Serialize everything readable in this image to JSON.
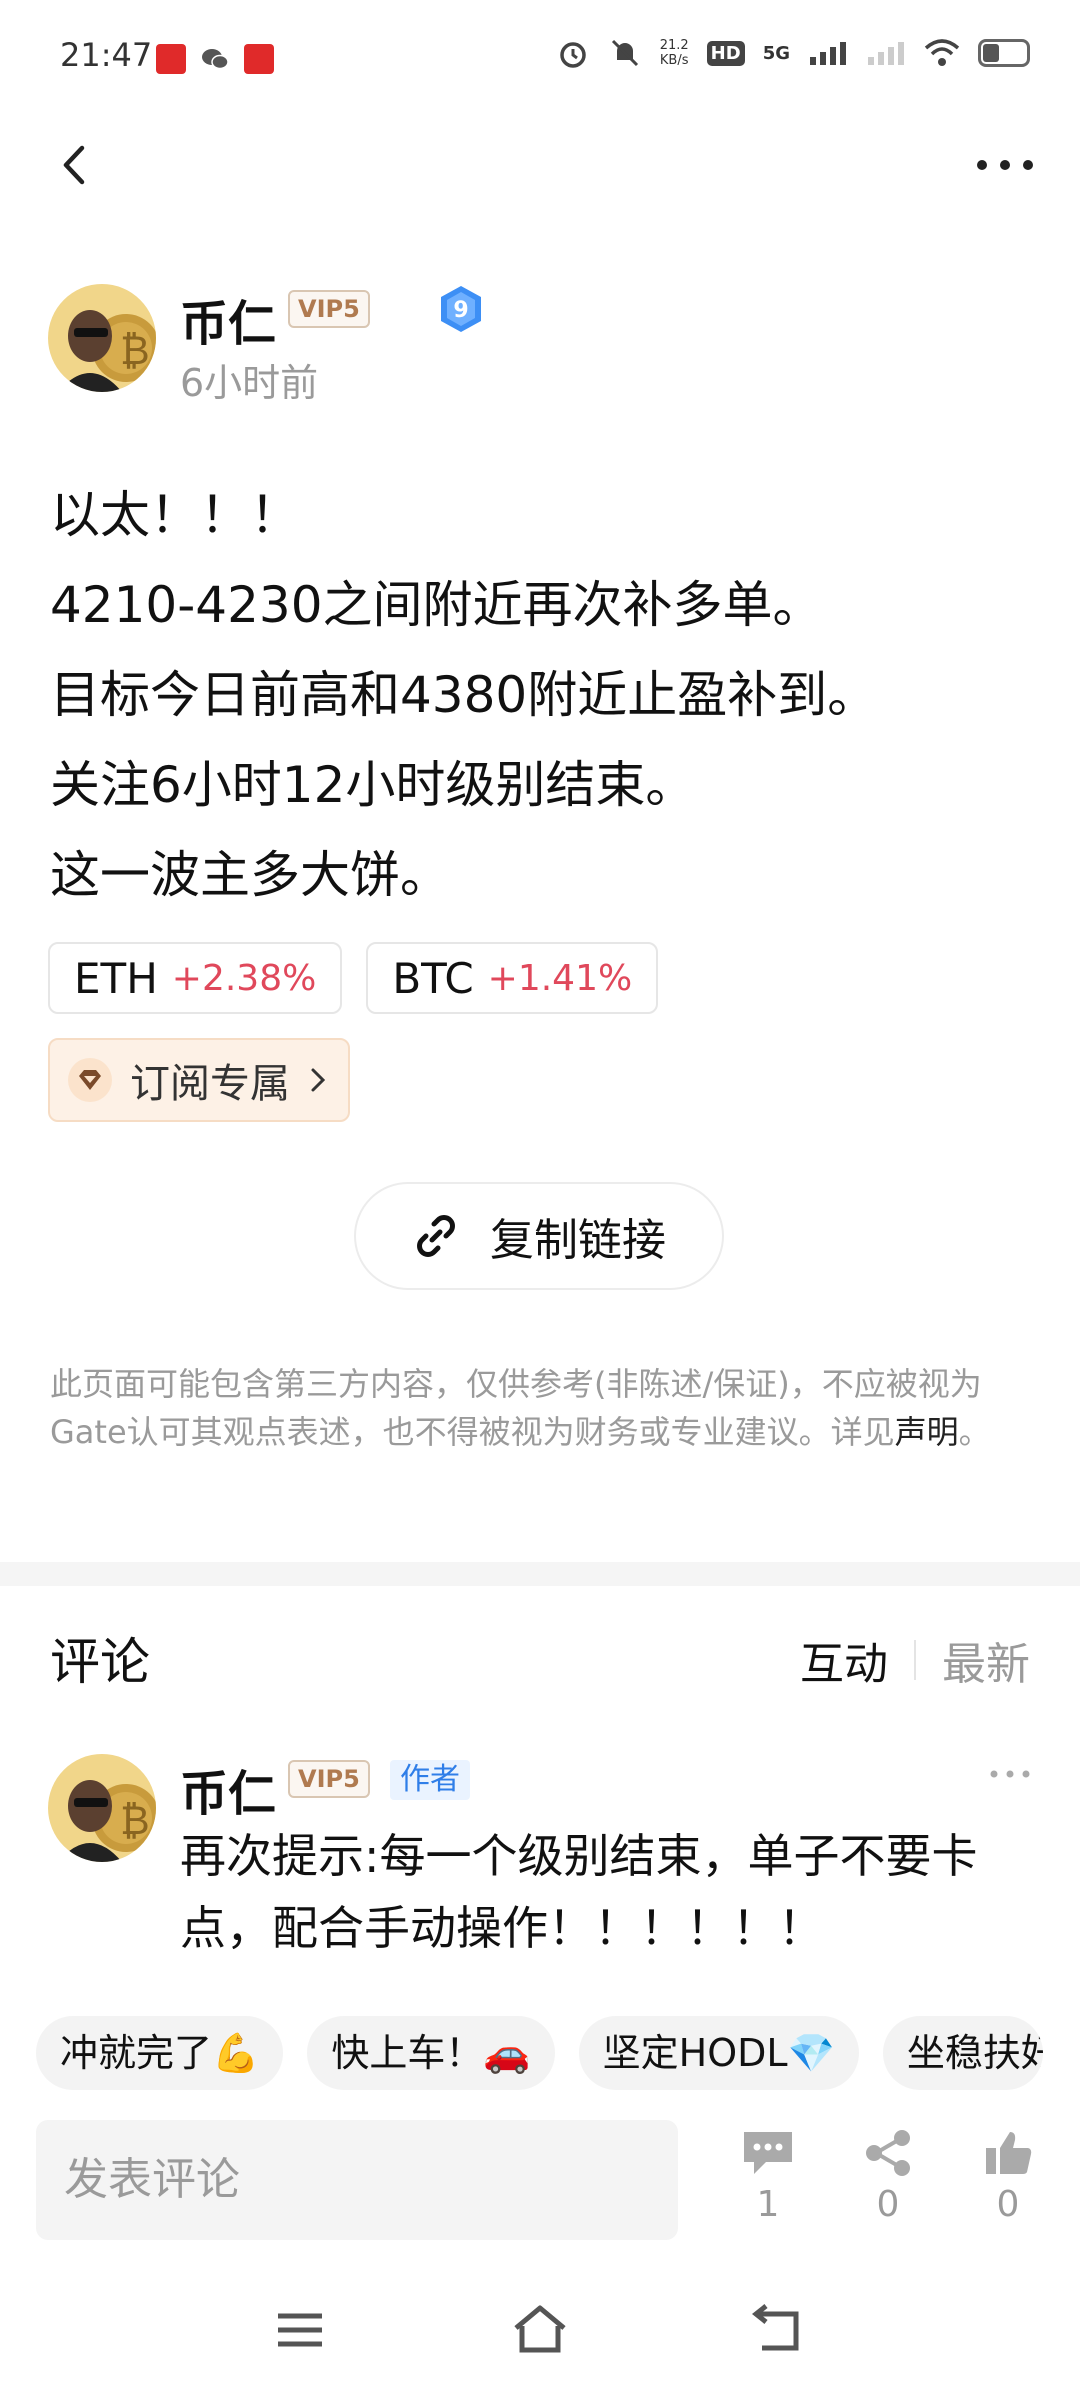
{
  "status_bar": {
    "time": "21:47",
    "net_speed_value": "21.2",
    "net_speed_unit": "KB/s",
    "hd_label": "HD",
    "sim_index": "1",
    "network": "5G"
  },
  "author": {
    "name": "币仁",
    "vip": "VIP5",
    "level": "9",
    "time": "6小时前"
  },
  "post": {
    "lines": [
      "以太！！！",
      "4210-4230之间附近再次补多单。",
      "目标今日前高和4380附近止盈补到。",
      "关注6小时12小时级别结束。",
      "这一波主多大饼。"
    ]
  },
  "tickers": [
    {
      "symbol": "ETH",
      "change": "+2.38%"
    },
    {
      "symbol": "BTC",
      "change": "+1.41%"
    }
  ],
  "subscribe": {
    "label": "订阅专属"
  },
  "copy_link": {
    "label": "复制链接"
  },
  "disclaimer": {
    "text": "此页面可能包含第三方内容，仅供参考(非陈述/保证)，不应被视为Gate认可其观点表述，也不得被视为财务或专业建议。详见",
    "link": "声明",
    "end": "。"
  },
  "comments": {
    "title": "评论",
    "sort_tabs": [
      "互动",
      "最新"
    ],
    "items": [
      {
        "name": "币仁",
        "vip": "VIP5",
        "tag": "作者",
        "text": "再次提示:每一个级别结束，单子不要卡点，配合手动操作！！！！！！"
      }
    ]
  },
  "quick_replies": [
    "冲就完了💪",
    "快上车！🚗",
    "坚定HODL💎",
    "坐稳扶好"
  ],
  "bottom_bar": {
    "input_placeholder": "发表评论",
    "comment_count": "1",
    "share_count": "0",
    "like_count": "0"
  },
  "colors": {
    "positive": "#e0485b",
    "author_tag": "#2f7ee8",
    "vip": "#b07a4f",
    "level_badge": "#3d8ff5"
  }
}
